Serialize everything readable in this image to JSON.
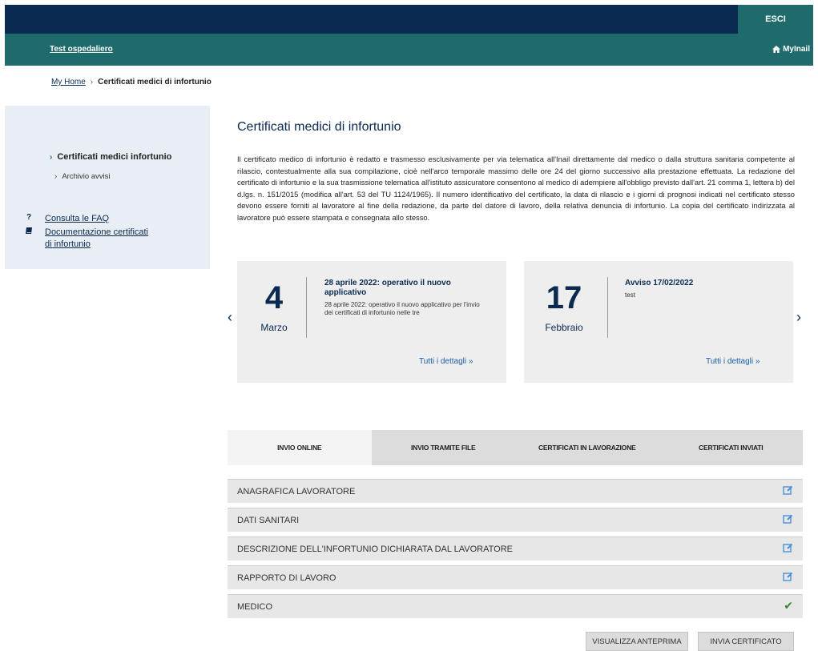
{
  "header": {
    "logout_label": "ESCI",
    "user_label": "Test ospedaliero",
    "myinail_label": "MyInail"
  },
  "breadcrumb": {
    "home": "My Home",
    "separator": "›",
    "current": "Certificati medici di infortunio"
  },
  "sidebar": {
    "main_item": "Certificati medici infortunio",
    "sub_item": "Archivio avvisi",
    "links": [
      {
        "icon": "question-icon",
        "label": "Consulta le FAQ"
      },
      {
        "icon": "book-icon",
        "label": "Documentazione certificati di infortunio"
      }
    ]
  },
  "main": {
    "title": "Certificati medici di infortunio",
    "intro": "Il certificato medico di infortunio è redatto e trasmesso esclusivamente per via telematica all'Inail direttamente dal medico o dalla struttura sanitaria competente al rilascio, contestualmente alla sua compilazione, cioè nell'arco temporale massimo delle ore 24 del giorno successivo alla prestazione effettuata. La redazione del certificato di infortunio e la sua trasmissione telematica all'istituto assicuratore consentono al medico di adempiere all'obbligo previsto dall'art. 21 comma 1, lettera b) del d.lgs. n. 151/2015 (modifica all'art. 53 del TU 1124/1965). Il numero identificativo del certificato, la data di rilascio e i giorni di prognosi indicati nel certificato stesso devono essere forniti al lavoratore al fine della redazione, da parte del datore di lavoro, della relativa denuncia di infortunio. La copia del certificato indirizzata al lavoratore può essere stampata e consegnata allo stesso."
  },
  "news": [
    {
      "day": "4",
      "month": "Marzo",
      "title": "28 aprile 2022: operativo il nuovo applicativo",
      "body": "28 aprile 2022: operativo il nuovo applicativo per l'invio dei certificati di infortunio nelle tre",
      "details": "Tutti i dettagli  »"
    },
    {
      "day": "17",
      "month": "Febbraio",
      "title": "Avviso 17/02/2022",
      "body": "test",
      "details": "Tutti i dettagli  »"
    }
  ],
  "tabs": [
    "INVIO ONLINE",
    "INVIO TRAMITE FILE",
    "CERTIFICATI IN LAVORAZIONE",
    "CERTIFICATI INVIATI"
  ],
  "sections": [
    {
      "label": "ANAGRAFICA LAVORATORE",
      "status": "edit"
    },
    {
      "label": "DATI SANITARI",
      "status": "edit"
    },
    {
      "label": "DESCRIZIONE DELL'INFORTUNIO DICHIARATA DAL LAVORATORE",
      "status": "edit"
    },
    {
      "label": "RAPPORTO DI LAVORO",
      "status": "edit"
    },
    {
      "label": "MEDICO",
      "status": "complete"
    }
  ],
  "buttons": {
    "preview": "VISUALIZZA ANTEPRIMA",
    "send": "INVIA CERTIFICATO"
  },
  "colors": {
    "navy": "#0a2a52",
    "teal": "#1f6b6b",
    "link_blue": "#1a5da6",
    "check_green": "#2e8b2e"
  }
}
